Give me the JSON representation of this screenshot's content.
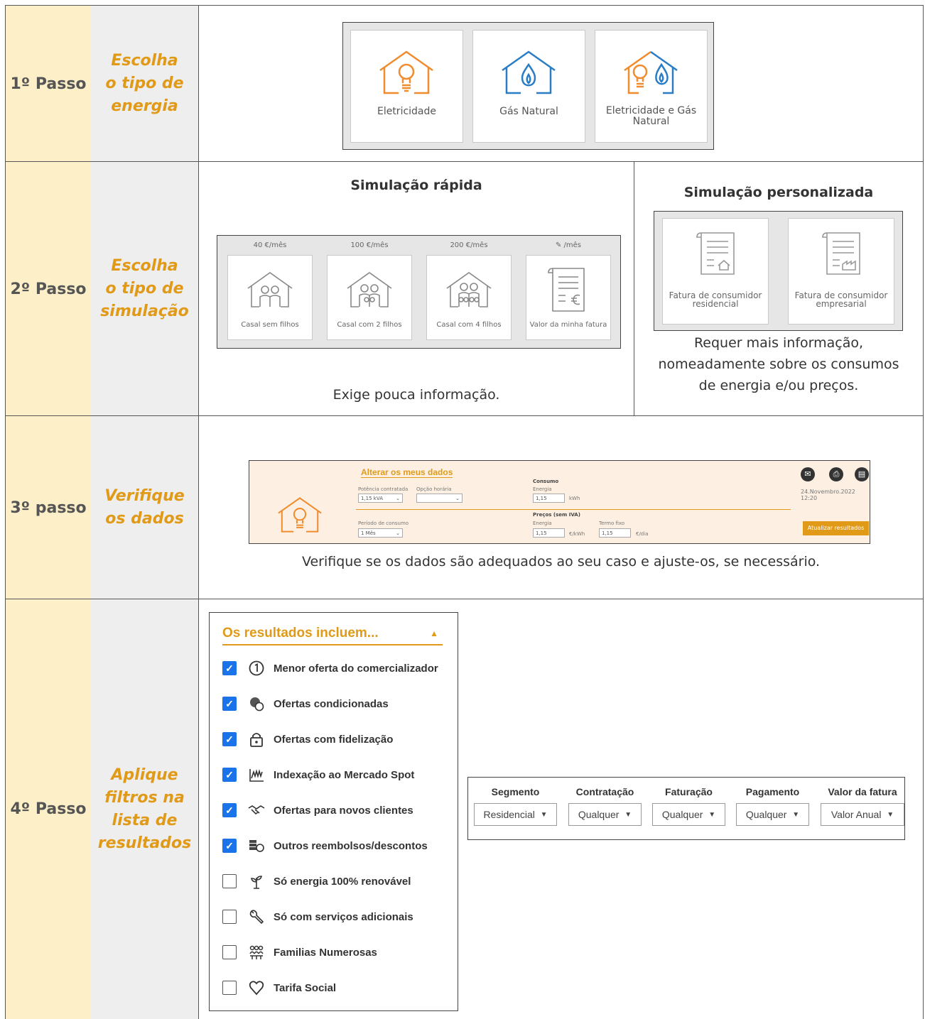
{
  "steps": [
    {
      "step": "1º Passo",
      "desc_lines": [
        "Escolha",
        "o tipo de",
        "energia"
      ]
    },
    {
      "step": "2º Passo",
      "desc_lines": [
        "Escolha",
        "o tipo de",
        "simulação"
      ]
    },
    {
      "step": "3º passo",
      "desc_lines": [
        "Verifique",
        "os dados"
      ]
    },
    {
      "step": "4º Passo",
      "desc_lines": [
        "Aplique",
        "filtros na",
        "lista de",
        "resultados"
      ]
    }
  ],
  "energy_cards": [
    {
      "label": "Eletricidade",
      "icon": "house-bulb-icon",
      "color": "#f08c2e"
    },
    {
      "label": "Gás Natural",
      "icon": "house-flame-icon",
      "color": "#2a7dc4"
    },
    {
      "label": "Eletricidade e Gás Natural",
      "icon": "house-bulb-flame-icon",
      "color": "#f08c2e"
    }
  ],
  "quick_sim": {
    "title": "Simulação rápida",
    "note": "Exige pouca informação.",
    "cards": [
      {
        "price": "40 €/mês",
        "label": "Casal sem filhos",
        "icon": "house-couple-icon"
      },
      {
        "price": "100 €/mês",
        "label": "Casal com 2 filhos",
        "icon": "house-family2-icon"
      },
      {
        "price": "200 €/mês",
        "label": "Casal com 4 filhos",
        "icon": "house-family4-icon"
      },
      {
        "price": "/mês",
        "label": "Valor da minha fatura",
        "icon": "invoice-euro-icon"
      }
    ]
  },
  "custom_sim": {
    "title": "Simulação personalizada",
    "note_lines": [
      "Requer mais informação,",
      "nomeadamente sobre os consumos",
      "de energia e/ou preços."
    ],
    "cards": [
      {
        "label": "Fatura de consumidor residencial",
        "icon": "invoice-house-icon"
      },
      {
        "label": "Fatura de consumidor empresarial",
        "icon": "invoice-factory-icon"
      }
    ]
  },
  "data_form": {
    "title": "Alterar os meus dados",
    "potencia_label": "Potência contratada",
    "potencia_value": "1,15 kVA",
    "opcao_label": "Opção horária",
    "opcao_value": "",
    "periodo_label": "Período de consumo",
    "periodo_value": "1 Mês",
    "consumo_title": "Consumo",
    "energia_label": "Energia",
    "energia_value": "1,15",
    "energia_unit": "kWh",
    "precos_title": "Preços (sem IVA)",
    "preco_energia_label": "Energia",
    "preco_energia_value": "1,15",
    "preco_energia_unit": "€/kWh",
    "termo_label": "Termo fixo",
    "termo_value": "1,15",
    "termo_unit": "€/dia",
    "date": "24.Novembro.2022 12:20",
    "update_button": "Atualizar resultados",
    "note": "Verifique se os dados são adequados ao seu caso e ajuste-os, se necessário."
  },
  "filters": {
    "title": "Os resultados incluem...",
    "items": [
      {
        "label": "Menor oferta do comercializador",
        "checked": true,
        "icon": "number-one-icon"
      },
      {
        "label": "Ofertas condicionadas",
        "checked": true,
        "icon": "coins-condition-icon"
      },
      {
        "label": "Ofertas com fidelização",
        "checked": true,
        "icon": "lock-icon"
      },
      {
        "label": "Indexação ao Mercado Spot",
        "checked": true,
        "icon": "market-spot-icon"
      },
      {
        "label": "Ofertas para novos clientes",
        "checked": true,
        "icon": "handshake-icon"
      },
      {
        "label": "Outros reembolsos/descontos",
        "checked": true,
        "icon": "coins-refund-icon"
      },
      {
        "label": "Só energia 100% renovável",
        "checked": false,
        "icon": "plant-icon"
      },
      {
        "label": "Só com serviços adicionais",
        "checked": false,
        "icon": "wrench-icon"
      },
      {
        "label": "Familias Numerosas",
        "checked": false,
        "icon": "family-icon"
      },
      {
        "label": "Tarifa Social",
        "checked": false,
        "icon": "heart-icon"
      }
    ]
  },
  "segments": [
    {
      "header": "Segmento",
      "value": "Residencial"
    },
    {
      "header": "Contratação",
      "value": "Qualquer"
    },
    {
      "header": "Faturação",
      "value": "Qualquer"
    },
    {
      "header": "Pagamento",
      "value": "Qualquer"
    },
    {
      "header": "Valor da fatura",
      "value": "Valor Anual"
    }
  ],
  "colors": {
    "accent": "#e09a18",
    "step_bg": "#fdf0c9",
    "desc_bg": "#eeeeee",
    "check": "#1a73e8",
    "orange": "#f08c2e",
    "blue": "#2a7dc4"
  }
}
